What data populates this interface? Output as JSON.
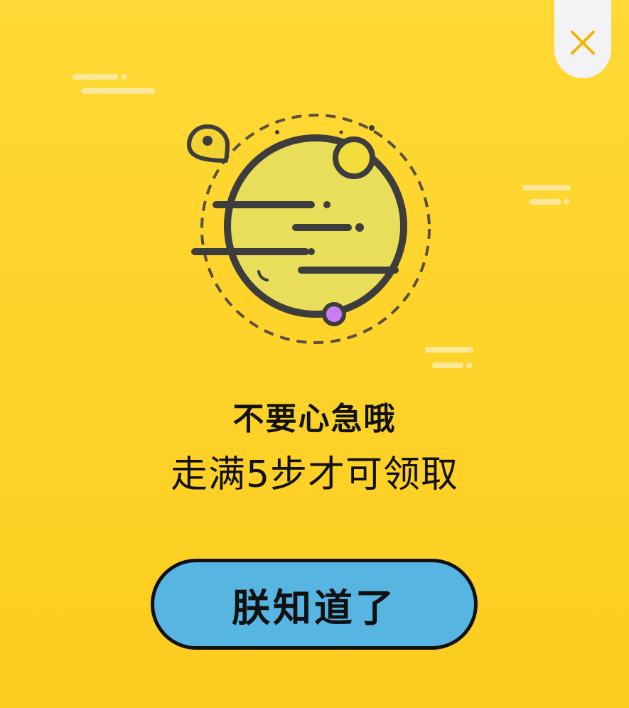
{
  "dialog": {
    "title": "不要心急哦",
    "message": "走满5步才可领取",
    "confirm_label": "朕知道了"
  },
  "icons": {
    "close": "close-icon",
    "illustration": "planet-illustration",
    "location_pin": "location-pin-icon"
  },
  "colors": {
    "background": "#ffd935",
    "button": "#57b5e2",
    "close_tab": "#f3f3f5",
    "close_icon": "#f5b400",
    "planet": "#e8de5a",
    "moon_dot": "#c87df0"
  }
}
